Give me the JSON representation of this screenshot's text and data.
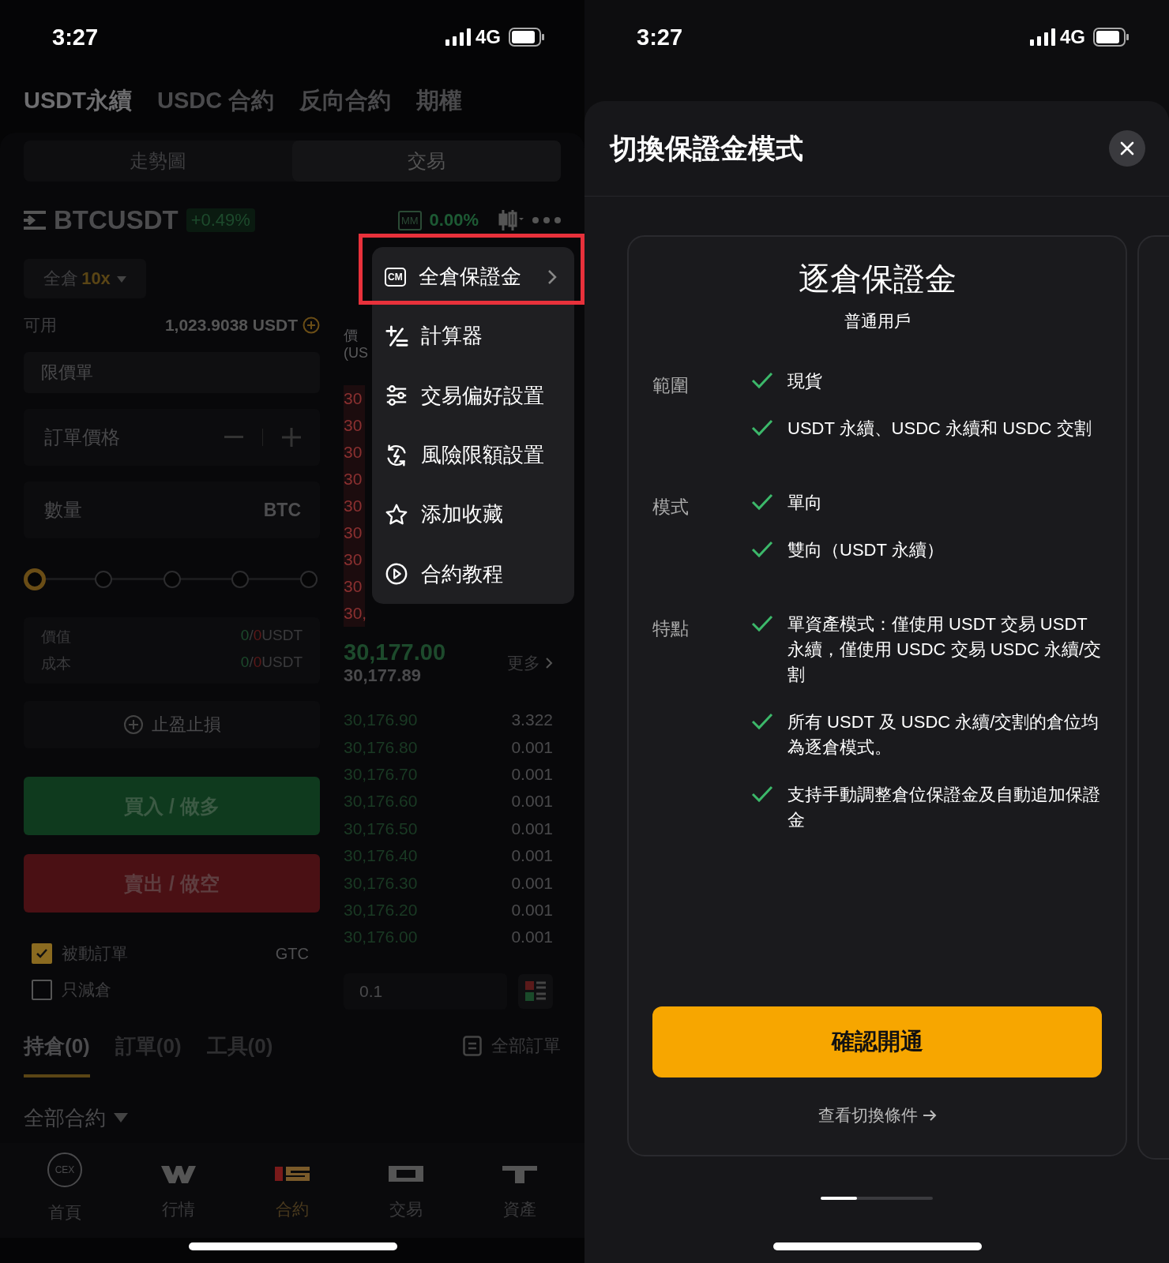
{
  "left_screen": {
    "status_bar": {
      "time": "3:27",
      "network": "4G"
    },
    "product_tabs": [
      {
        "label": "USDT永續",
        "selected": true
      },
      {
        "label": "USDC 合約",
        "selected": false
      },
      {
        "label": "反向合約",
        "selected": false
      },
      {
        "label": "期權",
        "selected": false
      }
    ],
    "view_tabs": [
      {
        "label": "走勢圖",
        "selected": false
      },
      {
        "label": "交易",
        "selected": true
      }
    ],
    "symbol": {
      "name": "BTCUSDT",
      "change": "+0.49%",
      "mm_label": "MM",
      "mm_value": "0.00%"
    },
    "margin_button": {
      "mode": "全倉",
      "leverage": "10x"
    },
    "available": {
      "label": "可用",
      "value": "1,023.9038 USDT"
    },
    "order_type": "限價單",
    "price_field": {
      "placeholder": "訂單價格"
    },
    "quantity_field": {
      "placeholder": "數量",
      "unit": "BTC"
    },
    "leverage_slider": {
      "level": 0
    },
    "summary": [
      {
        "label": "價值",
        "long": "0",
        "separator": "/",
        "short": "0",
        "unit": "USDT"
      },
      {
        "label": "成本",
        "long": "0",
        "separator": "/",
        "short": "0",
        "unit": "USDT"
      }
    ],
    "tpsl_button": "止盈止損",
    "buy_button": "買入 / 做多",
    "sell_button": "賣出 / 做空",
    "options": [
      {
        "label": "被動訂單",
        "checked": true
      },
      {
        "label": "只減倉",
        "checked": false
      }
    ],
    "time_in_force": "GTC",
    "order_book": {
      "header": [
        "價",
        "(US"
      ],
      "asks": [
        "30",
        "30",
        "30",
        "30",
        "30",
        "30",
        "30",
        "30",
        "30,"
      ],
      "last_price": "30,177.00",
      "mark_price": "30,177.89",
      "more": "更多",
      "bids": [
        {
          "price": "30,176.90",
          "qty": "3.322"
        },
        {
          "price": "30,176.80",
          "qty": "0.001"
        },
        {
          "price": "30,176.70",
          "qty": "0.001"
        },
        {
          "price": "30,176.60",
          "qty": "0.001"
        },
        {
          "price": "30,176.50",
          "qty": "0.001"
        },
        {
          "price": "30,176.40",
          "qty": "0.001"
        },
        {
          "price": "30,176.30",
          "qty": "0.001"
        },
        {
          "price": "30,176.20",
          "qty": "0.001"
        },
        {
          "price": "30,176.00",
          "qty": "0.001"
        }
      ],
      "step": "0.1"
    },
    "position_tabs": [
      {
        "label": "持倉(0)",
        "selected": true
      },
      {
        "label": "訂單(0)",
        "selected": false
      },
      {
        "label": "工具(0)",
        "selected": false
      }
    ],
    "all_orders": "全部訂單",
    "filter": "全部合約",
    "nav": [
      {
        "label": "首頁",
        "kind": "home",
        "badge": "CEX",
        "selected": false
      },
      {
        "label": "行情",
        "kind": "markets",
        "selected": false
      },
      {
        "label": "合約",
        "kind": "contracts",
        "selected": true
      },
      {
        "label": "交易",
        "kind": "trade",
        "selected": false
      },
      {
        "label": "資產",
        "kind": "assets",
        "selected": false
      }
    ],
    "menu": [
      {
        "label": "全倉保證金",
        "kind": "cm",
        "badge": "CM",
        "submenu": true,
        "highlighted": true
      },
      {
        "label": "計算器",
        "kind": "calculator",
        "submenu": false,
        "highlighted": false
      },
      {
        "label": "交易偏好設置",
        "kind": "sliders",
        "submenu": false,
        "highlighted": false
      },
      {
        "label": "風險限額設置",
        "kind": "risk",
        "submenu": false,
        "highlighted": false
      },
      {
        "label": "添加收藏",
        "kind": "star",
        "submenu": false,
        "highlighted": false
      },
      {
        "label": "合約教程",
        "kind": "play",
        "submenu": false,
        "highlighted": false
      }
    ]
  },
  "right_screen": {
    "status_bar": {
      "time": "3:27",
      "network": "4G"
    },
    "sheet": {
      "title": "切換保證金模式",
      "card": {
        "title": "逐倉保證金",
        "subtitle": "普通用戶",
        "sections": [
          {
            "label": "範圍",
            "items": [
              "現貨",
              "USDT 永續、USDC 永續和 USDC 交割"
            ]
          },
          {
            "label": "模式",
            "items": [
              "單向",
              "雙向（USDT 永續）"
            ]
          },
          {
            "label": "特點",
            "items": [
              "單資產模式：僅使用 USDT 交易 USDT 永續，僅使用 USDC 交易 USDC 永續/交割",
              "所有 USDT 及 USDC 永續/交割的倉位均為逐倉模式。",
              "支持手動調整倉位保證金及自動追加保證金"
            ]
          }
        ],
        "confirm_button": "確認開通",
        "conditions_link": "查看切換條件"
      }
    }
  }
}
